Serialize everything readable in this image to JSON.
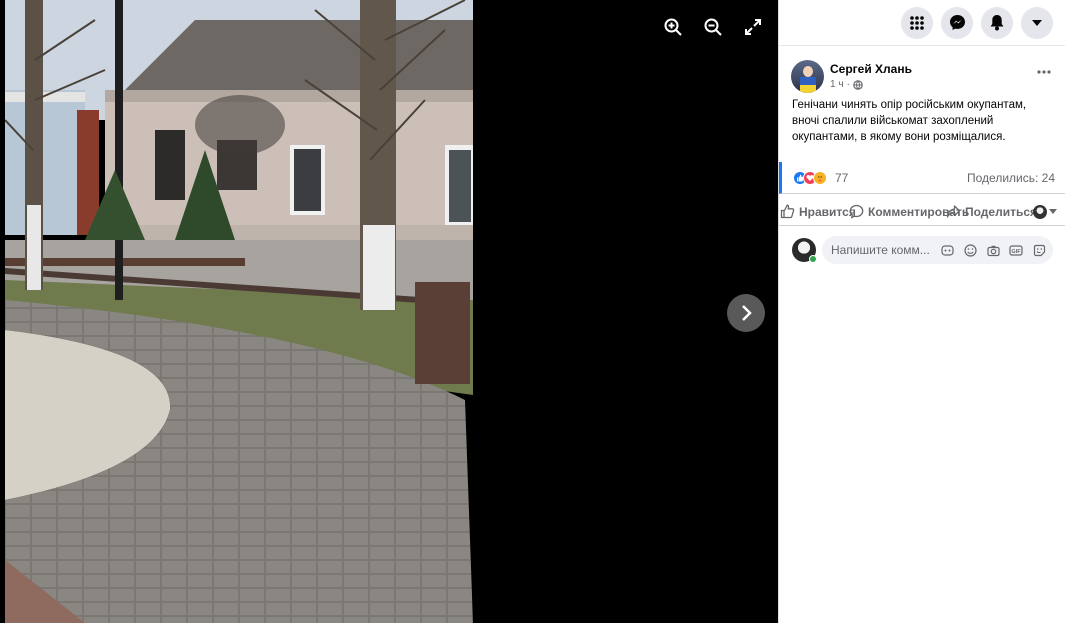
{
  "viewer": {
    "tools": [
      "zoom-in-icon",
      "zoom-out-icon",
      "fullscreen-icon"
    ],
    "next": "chevron-right-icon"
  },
  "topbar": {
    "buttons": [
      "menu-grid-icon",
      "messenger-icon",
      "bell-icon",
      "chevron-down-icon"
    ]
  },
  "post": {
    "author": "Сергей Хлань",
    "time": "1 ч",
    "dot": "·",
    "text": "Генічани чинять опір російським окупантам, вночі спалили військомат захоплений окупантами, в якому вони розміщалися.",
    "reactions_count": "77",
    "shares": "Поделились: 24"
  },
  "actions": {
    "like": "Нравится",
    "comment": "Комментировать",
    "share": "Поделиться"
  },
  "comment": {
    "placeholder": "Напишите комм..."
  },
  "colors": {
    "accent": "#1877f2",
    "like": "#1877f2",
    "love": "#f33e58",
    "care": "#f7b125",
    "online": "#31a24c"
  }
}
